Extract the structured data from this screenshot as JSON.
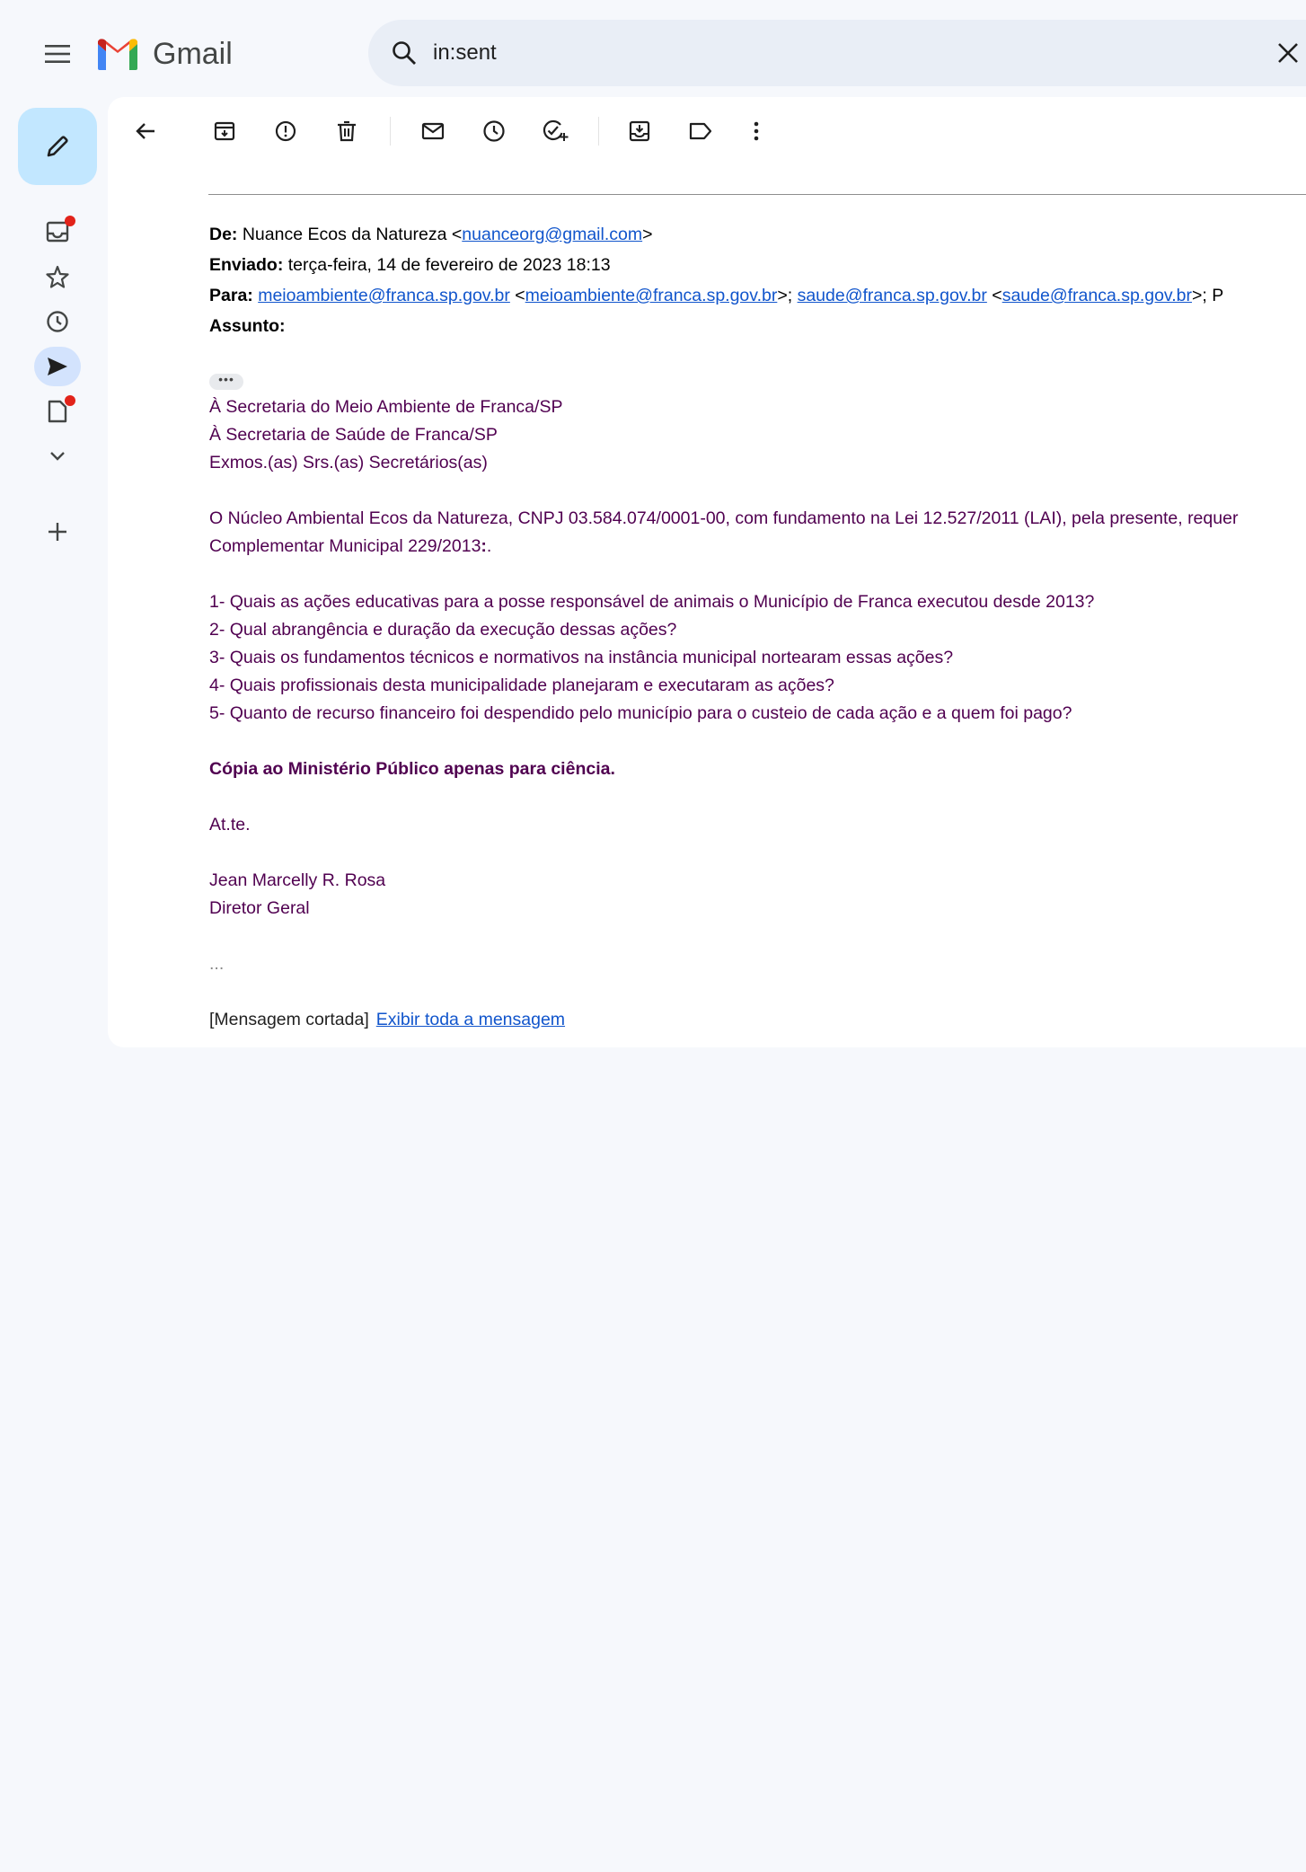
{
  "header": {
    "app_name": "Gmail",
    "search_value": "in:sent"
  },
  "email": {
    "de_label": "De:",
    "de_name": "Nuance Ecos da Natureza",
    "de_email": "nuanceorg@gmail.com",
    "enviado_label": "Enviado:",
    "enviado_value": "terça-feira, 14 de fevereiro de 2023 18:13",
    "para_label": "Para:",
    "para_1": "meioambiente@franca.sp.gov.br",
    "para_1_addr": "meioambiente@franca.sp.gov.br",
    "para_2": "saude@franca.sp.gov.br",
    "para_2_addr": "saude@franca.sp.gov.br",
    "para_tail": "; P",
    "assunto_label": "Assunto:",
    "ellipsis": "•••",
    "body": {
      "l1": "À Secretaria do Meio Ambiente de Franca/SP",
      "l2": "À Secretaria de Saúde de Franca/SP",
      "l3": "Exmos.(as) Srs.(as) Secretários(as)",
      "p1a": "O Núcleo Ambiental Ecos da  Natureza, CNPJ 03.584.074/0001-00, com fundamento na Lei 12.527/2011 (LAI), pela presente, requer",
      "p1b_text": "Complementar Municipal 229/2013",
      "p1b_colon": ":",
      "p1b_dot": ".",
      "q1": "1- Quais as ações educativas para a posse responsável de animais o Município de Franca  executou desde 2013?",
      "q2": "2- Qual  abrangência e duração da execução dessas ações?",
      "q3": "3- Quais os fundamentos técnicos e normativos na instância municipal nortearam essas ações?",
      "q4": "4- Quais profissionais desta municipalidade planejaram e executaram as ações?",
      "q5": "5- Quanto de recurso financeiro foi despendido pelo município para o custeio de cada ação e a quem foi pago?",
      "copia": "Cópia ao Ministério Público apenas para ciência.",
      "atte": "At.te.",
      "sig_name": "Jean Marcelly R. Rosa",
      "sig_title": "Diretor Geral",
      "dots": "..."
    },
    "clipped": "[Mensagem cortada]",
    "show_all": "Exibir toda a mensagem"
  },
  "colors": {
    "background": "#f6f8fc",
    "compose": "#c2e7ff",
    "active_rail": "#d3e3fd",
    "body_text": "#500050",
    "link": "#1155cc",
    "badge": "#e2231a"
  }
}
